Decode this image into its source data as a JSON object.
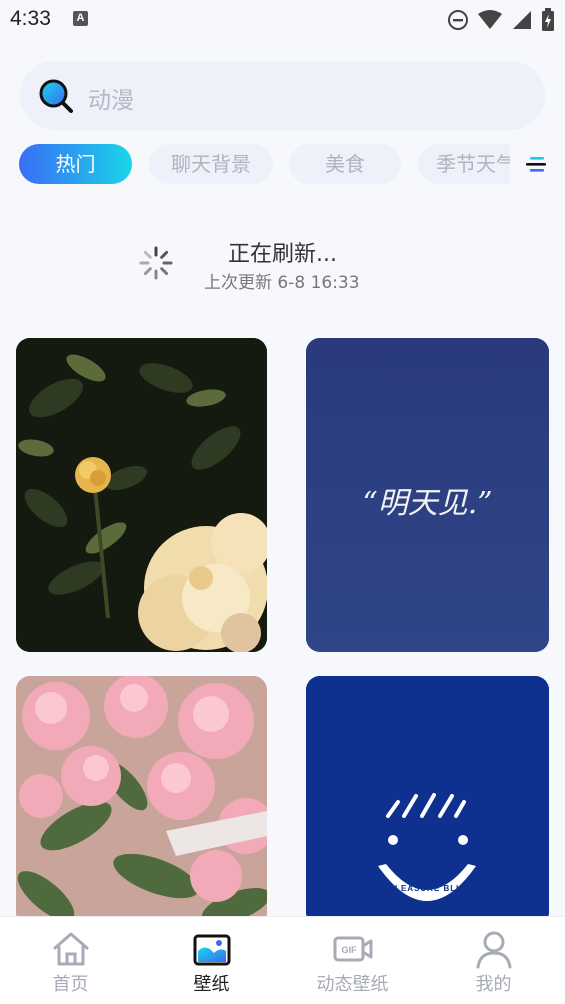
{
  "status_bar": {
    "time": "4:33",
    "notification_glyph": "A",
    "icons": [
      "do-not-disturb-icon",
      "wifi-icon",
      "cell-signal-icon",
      "battery-icon"
    ]
  },
  "search": {
    "placeholder": "动漫"
  },
  "tabs": [
    {
      "label": "热门",
      "active": true
    },
    {
      "label": "聊天背景",
      "active": false
    },
    {
      "label": "美食",
      "active": false
    },
    {
      "label": "季节天气",
      "active": false
    }
  ],
  "refresh": {
    "title": "正在刷新...",
    "last_update": "上次更新 6-8 16:33"
  },
  "wallpapers": [
    {
      "description_icon": "rose-photo-dark"
    },
    {
      "text": "“明天见.”"
    },
    {
      "description_icon": "pink-roses-photo"
    },
    {
      "text": "PLEASURE BLUE"
    }
  ],
  "bottom_nav": [
    {
      "label": "首页",
      "icon": "home-icon",
      "active": false
    },
    {
      "label": "壁纸",
      "icon": "wallpaper-icon",
      "active": true
    },
    {
      "label": "动态壁纸",
      "icon": "gif-video-icon",
      "active": false
    },
    {
      "label": "我的",
      "icon": "user-icon",
      "active": false
    }
  ],
  "colors": {
    "accent_start": "#3a6df5",
    "accent_end": "#19d5e8",
    "background": "#f7f8fc"
  }
}
